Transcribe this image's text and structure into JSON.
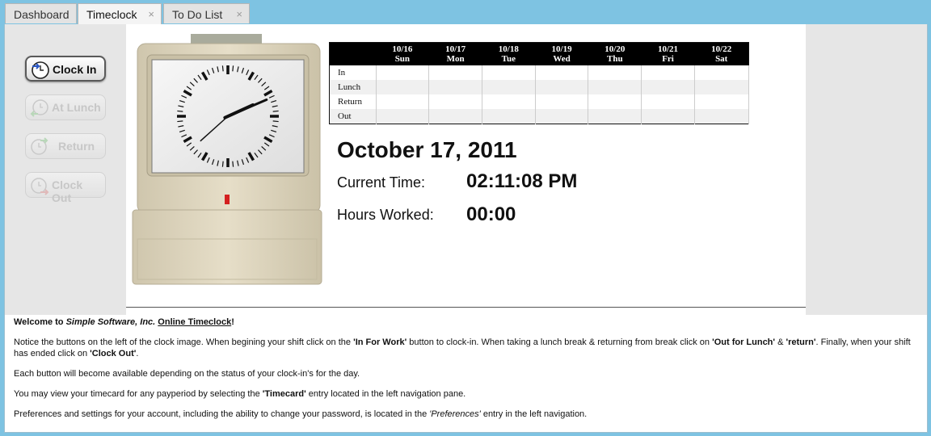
{
  "tabs": [
    {
      "label": "Dashboard",
      "closable": false,
      "active": false
    },
    {
      "label": "Timeclock",
      "closable": true,
      "active": true
    },
    {
      "label": "To Do List",
      "closable": true,
      "active": false
    }
  ],
  "tab_close_glyph": "×",
  "punch_buttons": {
    "clock_in": "Clock In",
    "at_lunch": "At Lunch",
    "return": "Return",
    "clock_out": "Clock Out"
  },
  "icons": {
    "clock_in": "clock-in-icon",
    "at_lunch": "lunch-icon",
    "return": "return-icon",
    "clock_out": "clock-out-icon",
    "clock": "time-clock-icon"
  },
  "clock_face": {
    "hours": 2,
    "minutes": 11,
    "seconds": 8
  },
  "schedule": {
    "days": [
      {
        "date": "10/16",
        "day": "Sun"
      },
      {
        "date": "10/17",
        "day": "Mon"
      },
      {
        "date": "10/18",
        "day": "Tue"
      },
      {
        "date": "10/19",
        "day": "Wed"
      },
      {
        "date": "10/20",
        "day": "Thu"
      },
      {
        "date": "10/21",
        "day": "Fri"
      },
      {
        "date": "10/22",
        "day": "Sat"
      }
    ],
    "rows": [
      "In",
      "Lunch",
      "Return",
      "Out"
    ]
  },
  "status": {
    "date": "October 17, 2011",
    "current_time_label": "Current Time:",
    "current_time": "02:11:08 PM",
    "hours_worked_label": "Hours Worked:",
    "hours_worked": "00:00"
  },
  "info": {
    "p1_welcome": "Welcome to ",
    "p1_company": "Simple Software, Inc.",
    "p1_link": "Online Timeclock",
    "p1_end": "!",
    "p2_a": "Notice the buttons on the left of the clock image. When begining your shift click on the ",
    "p2_b": "'In For Work'",
    "p2_c": " button to clock-in. When taking a lunch break & returning from break click on ",
    "p2_d": "'Out for Lunch'",
    "p2_e": " & ",
    "p2_f": "'return'",
    "p2_g": ". Finally, when your shift has ended click on ",
    "p2_h": "'Clock Out'",
    "p2_i": ".",
    "p3": "Each button will become available depending on the status of your clock-in's for the day.",
    "p4_a": "You may view your timecard for any payperiod by selecting the ",
    "p4_b": "'Timecard'",
    "p4_c": " entry located in the left navigation pane.",
    "p5_a": "Preferences and settings for your account, including the ability to change your password, is located in the ",
    "p5_b": "'Preferences'",
    "p5_c": " entry in the left navigation."
  },
  "colors": {
    "titlebar": "#7ec3e2",
    "panel": "#e6e6e6",
    "header": "#000000",
    "clock_body": "#ddd4bd",
    "indicator": "#d42020"
  }
}
